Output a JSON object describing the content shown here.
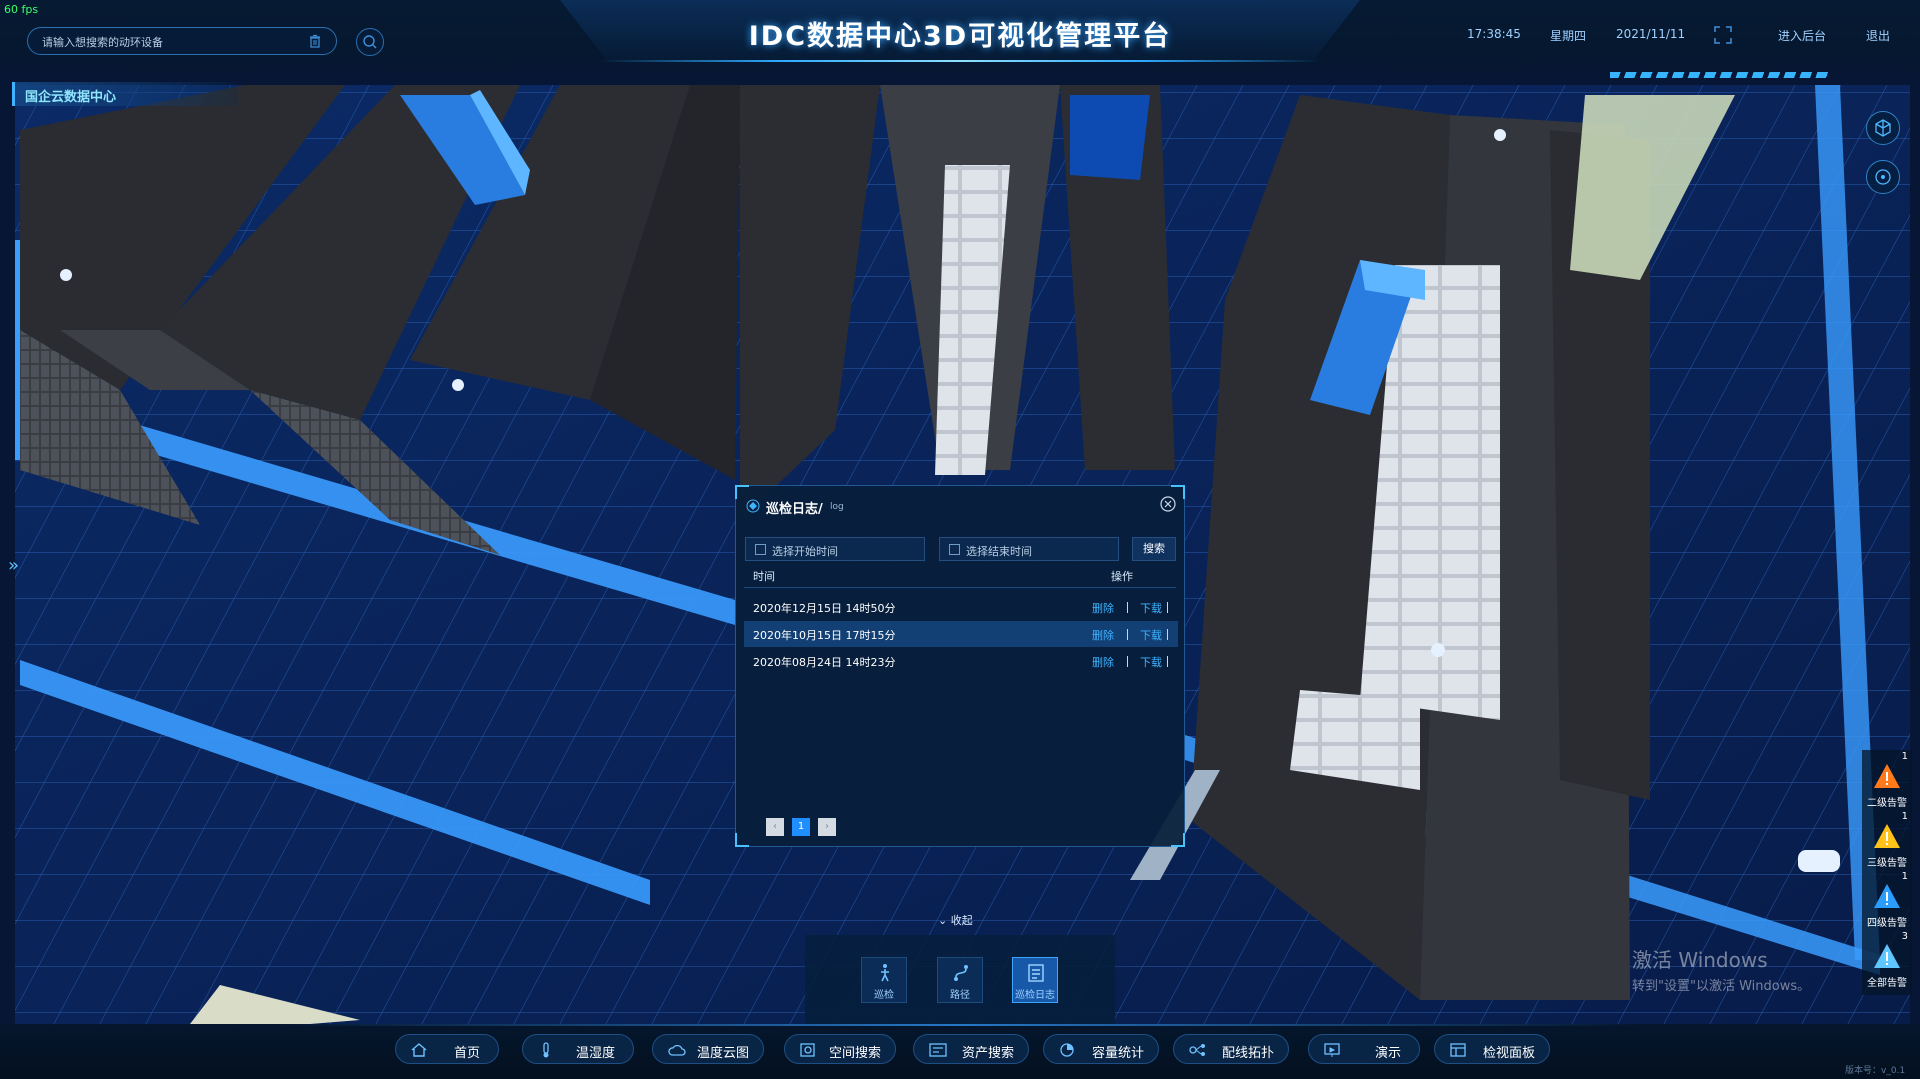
{
  "fps": "60 fps",
  "header": {
    "title": "IDC数据中心3D可视化管理平台",
    "search_placeholder": "请输入想搜索的动环设备",
    "clock": "17:38:45",
    "weekday": "星期四",
    "date": "2021/11/11",
    "backend_link": "进入后台",
    "logout_link": "退出"
  },
  "location": {
    "label": "国企云数据中心"
  },
  "dialog": {
    "title": "巡检日志/",
    "subtitle": "log",
    "start_time_placeholder": "选择开始时间",
    "end_time_placeholder": "选择结束时间",
    "search_button": "搜索",
    "columns": {
      "time": "时间",
      "operation": "操作"
    },
    "rows": [
      {
        "time": "2020年12月15日 14时50分",
        "delete": "删除",
        "download": "下载",
        "selected": false
      },
      {
        "time": "2020年10月15日 17时15分",
        "delete": "删除",
        "download": "下载",
        "selected": true
      },
      {
        "time": "2020年08月24日 14时23分",
        "delete": "删除",
        "download": "下载",
        "selected": false
      }
    ],
    "pagination": {
      "current_page": "1",
      "prev": "‹",
      "next": "›"
    }
  },
  "collapse_label": "收起",
  "tools": [
    {
      "label": "巡检",
      "icon": "walk-icon",
      "active": false
    },
    {
      "label": "路径",
      "icon": "route-icon",
      "active": false
    },
    {
      "label": "巡检日志",
      "icon": "log-icon",
      "active": true
    }
  ],
  "nav": [
    {
      "label": "首页",
      "icon": "home-icon"
    },
    {
      "label": "温湿度",
      "icon": "thermometer-icon"
    },
    {
      "label": "温度云图",
      "icon": "cloud-icon"
    },
    {
      "label": "空间搜索",
      "icon": "space-search-icon"
    },
    {
      "label": "资产搜索",
      "icon": "asset-icon"
    },
    {
      "label": "容量统计",
      "icon": "pie-icon"
    },
    {
      "label": "配线拓扑",
      "icon": "topology-icon"
    },
    {
      "label": "演示",
      "icon": "presentation-icon"
    },
    {
      "label": "检视面板",
      "icon": "panel-icon"
    }
  ],
  "alarms": [
    {
      "label": "二级告警",
      "count": "1",
      "color": "#ff7a1a"
    },
    {
      "label": "三级告警",
      "count": "1",
      "color": "#ffc21a"
    },
    {
      "label": "四级告警",
      "count": "1",
      "color": "#2a9dff"
    },
    {
      "label": "全部告警",
      "count": "3",
      "color": "#5fc6ff"
    }
  ],
  "watermark": {
    "title": "激活 Windows",
    "subtitle": "转到\"设置\"以激活 Windows。"
  },
  "version": "版本号：v_0.1",
  "colors": {
    "accent": "#3fb3ff",
    "selected_row": "#123f74",
    "panel_bg": "#081e3a"
  }
}
